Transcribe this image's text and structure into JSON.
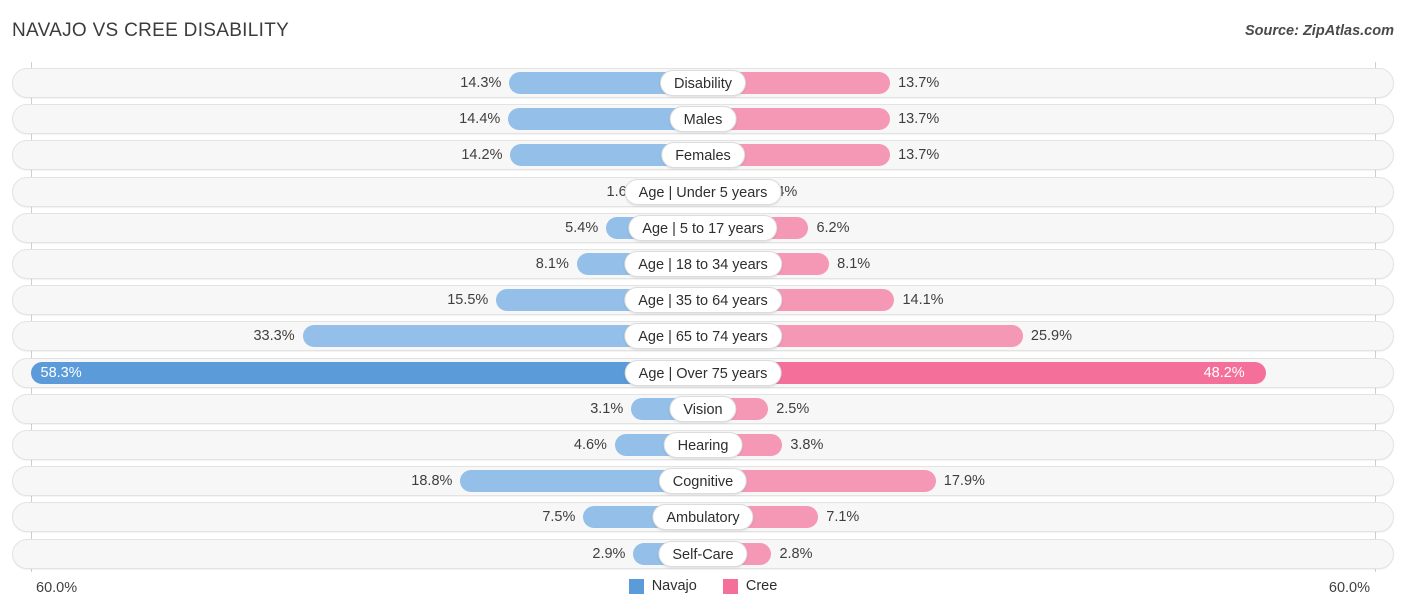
{
  "header": {
    "title": "NAVAJO VS CREE DISABILITY",
    "source": "Source: ZipAtlas.com"
  },
  "axis": {
    "left_label": "60.0%",
    "right_label": "60.0%",
    "max": 60.0
  },
  "legend": {
    "items": [
      {
        "label": "Navajo",
        "color": "#5b9bd9"
      },
      {
        "label": "Cree",
        "color": "#f4709b"
      }
    ]
  },
  "colors": {
    "navajo_light": "#93bfe8",
    "navajo_dark": "#5b9bd9",
    "cree_light": "#f598b5",
    "cree_dark": "#f4709b",
    "track": "#f7f7f7",
    "track_border": "#e3e3e3",
    "gridline": "#cfcfcf"
  },
  "chart_data": {
    "type": "bar",
    "orientation": "horizontal",
    "style": "diverging-bidirectional",
    "title": "NAVAJO VS CREE DISABILITY",
    "xlabel": "",
    "ylabel": "",
    "xlim": [
      0,
      60
    ],
    "grid": true,
    "legend_position": "bottom-center",
    "categories": [
      "Disability",
      "Males",
      "Females",
      "Age | Under 5 years",
      "Age | 5 to 17 years",
      "Age | 18 to 34 years",
      "Age | 35 to 64 years",
      "Age | 65 to 74 years",
      "Age | Over 75 years",
      "Vision",
      "Hearing",
      "Cognitive",
      "Ambulatory",
      "Self-Care"
    ],
    "series": [
      {
        "name": "Navajo",
        "side": "left",
        "values": [
          14.3,
          14.4,
          14.2,
          1.6,
          5.4,
          8.1,
          15.5,
          33.3,
          58.3,
          3.1,
          4.6,
          18.8,
          7.5,
          2.9
        ],
        "labels": [
          "14.3%",
          "14.4%",
          "14.2%",
          "1.6%",
          "5.4%",
          "8.1%",
          "15.5%",
          "33.3%",
          "58.3%",
          "3.1%",
          "4.6%",
          "18.8%",
          "7.5%",
          "2.9%"
        ]
      },
      {
        "name": "Cree",
        "side": "right",
        "values": [
          13.7,
          13.7,
          13.7,
          1.4,
          6.2,
          8.1,
          14.1,
          25.9,
          48.2,
          2.5,
          3.8,
          17.9,
          7.1,
          2.8
        ],
        "labels": [
          "13.7%",
          "13.7%",
          "13.7%",
          "1.4%",
          "6.2%",
          "8.1%",
          "14.1%",
          "25.9%",
          "48.2%",
          "2.5%",
          "3.8%",
          "17.9%",
          "7.1%",
          "2.8%"
        ]
      }
    ],
    "highlighted_row": "Age | Over 75 years"
  }
}
